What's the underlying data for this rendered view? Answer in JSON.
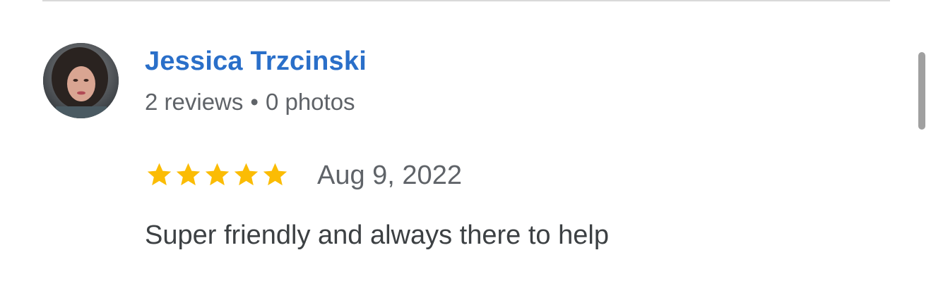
{
  "reviewer": {
    "name": "Jessica Trzcinski",
    "reviews_count": "2 reviews",
    "separator": "•",
    "photos_count": "0 photos"
  },
  "review": {
    "rating": 5,
    "max_rating": 5,
    "date": "Aug 9, 2022",
    "text": "Super friendly and always there to help"
  },
  "colors": {
    "name_link": "#2a6fc9",
    "star": "#fbbc04",
    "meta_text": "#5f6368",
    "body_text": "#3c4043"
  },
  "icons": {
    "star": "star-icon",
    "avatar": "user-avatar"
  }
}
